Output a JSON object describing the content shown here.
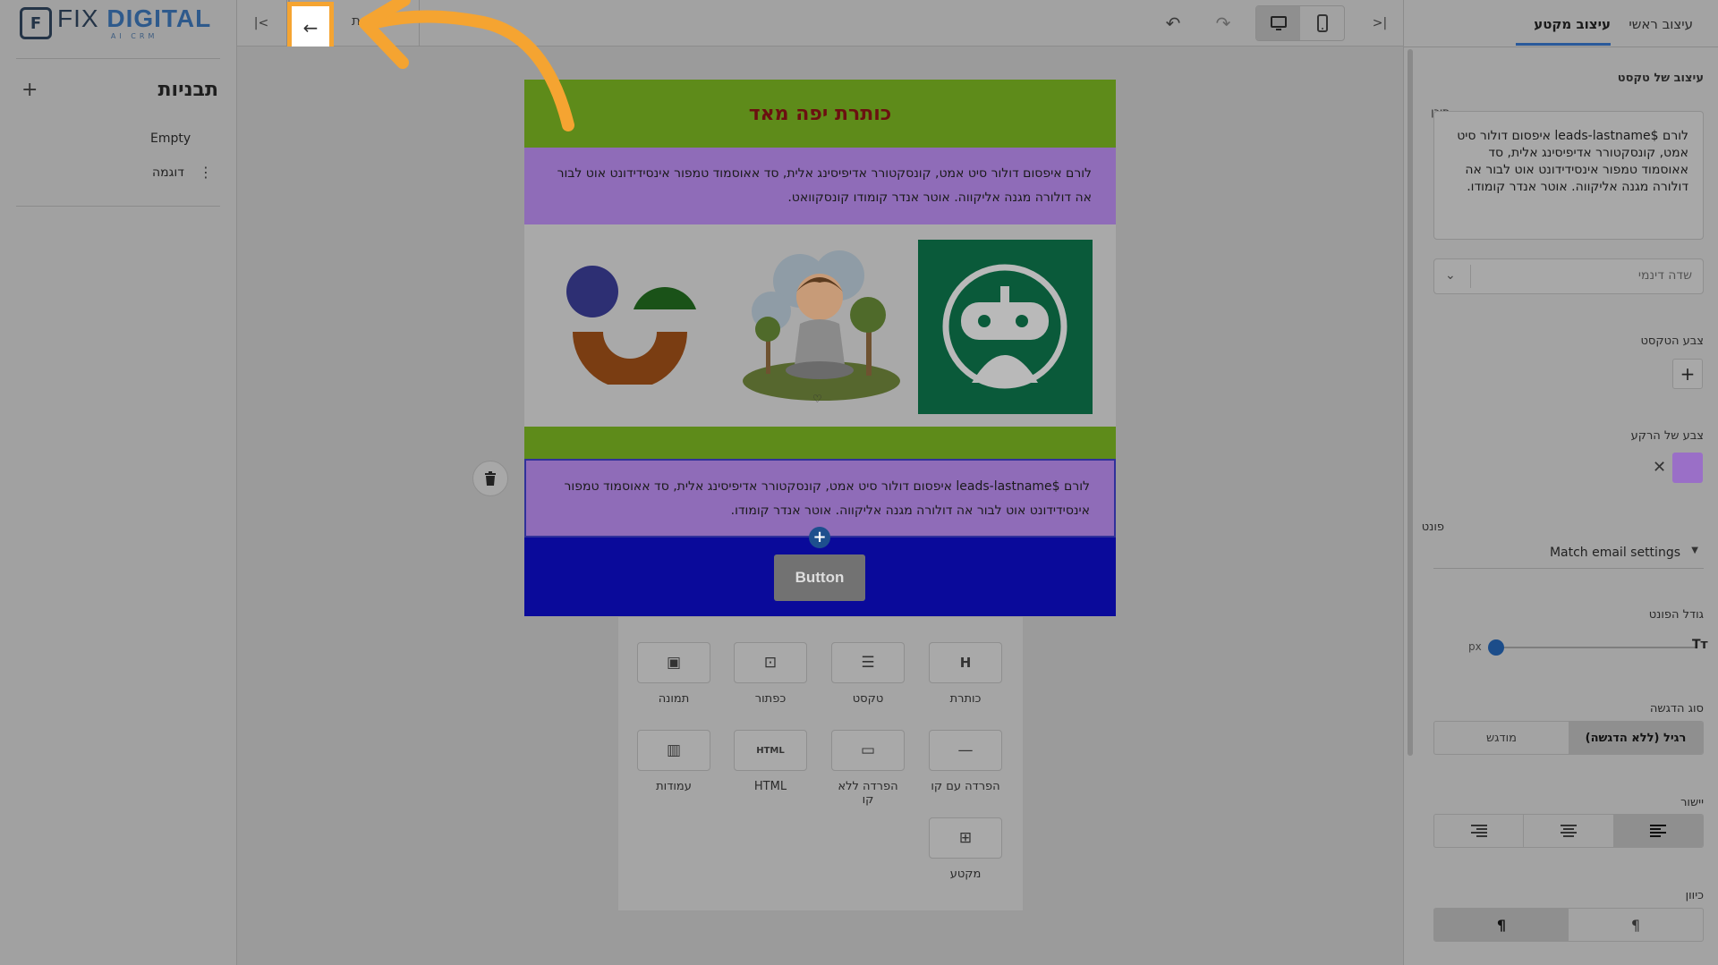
{
  "brand": {
    "name_part1": "FIX",
    "name_part2": "DIGITAL",
    "tagline": "AI CRM",
    "mark": "F"
  },
  "sidebar": {
    "title": "תבניות",
    "add_label": "+",
    "items": [
      {
        "label": "Empty"
      },
      {
        "label": "דוגמה",
        "menu": "⋮"
      }
    ]
  },
  "topbar": {
    "collapse_left": "|<",
    "back": "←",
    "partial_text": "ת",
    "undo": "↶",
    "redo": "↷",
    "collapse_right": ">|"
  },
  "email": {
    "heading": "כותרת יפה מאד",
    "para1": "לורם איפסום דולור סיט אמט, קונסקטורר אדיפיסינג אלית, סד אאוסמוד טמפור אינסידידונט אוט לבור אה דולורה מגנה אליקווה. אוטר אנדר קומודו קונסקוואט.",
    "para2": "לורם $leads-lastname איפסום דולור סיט אמט, קונסקטורר אדיפיסינג אלית, סד אאוסמוד טמפור אינסידידונט אוט לבור אה דולורה מגנה אליקווה. אוטר אנדר קומודו.",
    "button": "Button",
    "add": "+",
    "colors": {
      "header": "#5e8b1a",
      "purple": "#8f6cb8",
      "green": "#5e8b1a",
      "blue": "#0a0a9a",
      "heading_text": "#6b1010"
    }
  },
  "blocks": [
    {
      "label": "כותרת",
      "glyph": "H",
      "icon": "heading-icon"
    },
    {
      "label": "טקסט",
      "glyph": "☰",
      "icon": "text-icon"
    },
    {
      "label": "כפתור",
      "glyph": "⊡",
      "icon": "button-icon"
    },
    {
      "label": "תמונה",
      "glyph": "▣",
      "icon": "image-icon"
    },
    {
      "label": "הפרדה עם קו",
      "glyph": "—",
      "icon": "divider-line-icon"
    },
    {
      "label": "הפרדה ללא קו",
      "glyph": "▭",
      "icon": "spacer-icon"
    },
    {
      "label": "HTML",
      "glyph": "HTML",
      "icon": "html-icon"
    },
    {
      "label": "עמודות",
      "glyph": "▥",
      "icon": "columns-icon"
    },
    {
      "label": "מקטע",
      "glyph": "⊞",
      "icon": "section-icon"
    }
  ],
  "panel": {
    "tabs": [
      "עיצוב ראשי",
      "עיצוב מקטע"
    ],
    "section_title": "עיצוב של טקסט",
    "content_label": "תוכן",
    "content_value": "לורם  $leads-lastname איפסום דולור סיט אמט, קונסקטורר אדיפיסינג אלית, סד אאוסמוד טמפור אינסידידונט אוט לבור אה דולורה מגנה אליקווה. אוטר אנדר קומודו.",
    "dynamic_placeholder": "שדה דינמי",
    "text_color_label": "צבע הטקסט",
    "bg_color_label": "צבע של הרקע",
    "bg_color": "#9a6fc7",
    "font_label": "פונט",
    "font_value": "Match email settings",
    "font_size_label": "גודל הפונט",
    "px": "px",
    "size_icon": "Tт",
    "font_size_level": 0,
    "emphasis_label": "סוג הדגשה",
    "emphasis_options": [
      "רגיל (ללא הדגשה)",
      "מודגש"
    ],
    "align_label": "יישור",
    "direction_label": "כיוון"
  }
}
